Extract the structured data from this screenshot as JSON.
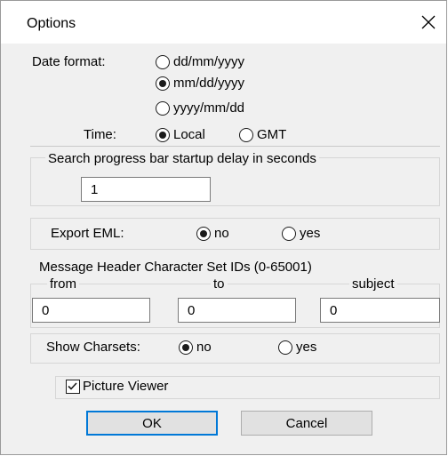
{
  "window": {
    "title": "Options"
  },
  "date_format": {
    "label": "Date format:",
    "options": [
      {
        "label": "dd/mm/yyyy",
        "selected": false
      },
      {
        "label": "mm/dd/yyyy",
        "selected": true
      },
      {
        "label": "yyyy/mm/dd",
        "selected": false
      }
    ]
  },
  "time": {
    "label": "Time:",
    "options": [
      {
        "label": "Local",
        "selected": true
      },
      {
        "label": "GMT",
        "selected": false
      }
    ]
  },
  "search_delay": {
    "label": "Search progress bar startup delay in seconds",
    "value": "1"
  },
  "export_eml": {
    "label": "Export EML:",
    "options": [
      {
        "label": "no",
        "selected": true
      },
      {
        "label": "yes",
        "selected": false
      }
    ]
  },
  "charset_ids": {
    "label": "Message Header Character Set IDs (0-65001)",
    "fields": [
      {
        "label": "from",
        "value": "0"
      },
      {
        "label": "to",
        "value": "0"
      },
      {
        "label": "subject",
        "value": "0"
      }
    ]
  },
  "show_charsets": {
    "label": "Show Charsets:",
    "options": [
      {
        "label": "no",
        "selected": true
      },
      {
        "label": "yes",
        "selected": false
      }
    ]
  },
  "picture_viewer": {
    "label": "Picture Viewer",
    "checked": true
  },
  "buttons": {
    "ok": "OK",
    "cancel": "Cancel"
  },
  "icons": {
    "close": "close-icon",
    "radio": "radio-button",
    "checkbox": "checkbox-checked"
  },
  "colors": {
    "dialog_bg": "#f0f0f0",
    "title_bg": "#ffffff",
    "accent": "#0078d7",
    "button_bg": "#e1e1e1"
  }
}
